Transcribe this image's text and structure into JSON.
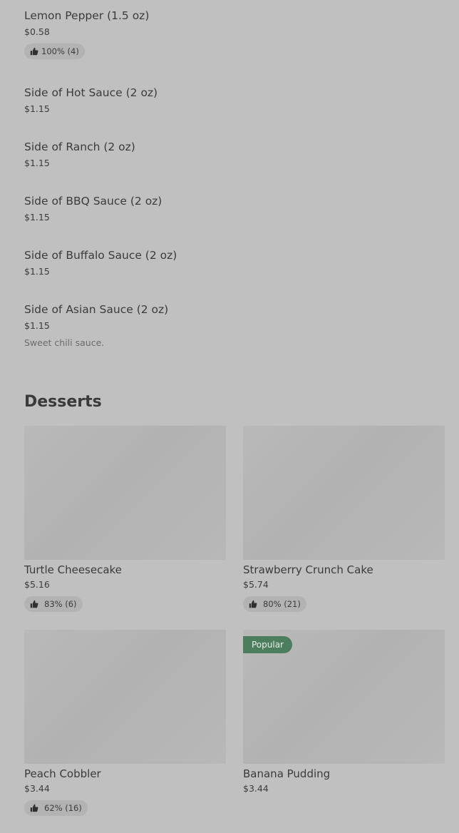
{
  "items": [
    {
      "title": "Lemon Pepper (1.5 oz)",
      "price": "$0.58",
      "rating": "100% (4)"
    },
    {
      "title": "Side of Hot Sauce (2 oz)",
      "price": "$1.15"
    },
    {
      "title": "Side of Ranch (2 oz)",
      "price": "$1.15"
    },
    {
      "title": "Side of BBQ Sauce (2 oz)",
      "price": "$1.15"
    },
    {
      "title": "Side of Buffalo Sauce (2 oz)",
      "price": "$1.15"
    },
    {
      "title": "Side of Asian Sauce (2 oz)",
      "price": "$1.15",
      "description": "Sweet chili sauce."
    }
  ],
  "desserts": {
    "heading": "Desserts",
    "cards": [
      {
        "title": "Turtle Cheesecake",
        "price": "$5.16",
        "rating": "83% (6)"
      },
      {
        "title": "Strawberry Crunch Cake",
        "price": "$5.74",
        "rating": "80% (21)"
      },
      {
        "title": "Peach Cobbler",
        "price": "$3.44",
        "rating": "62% (16)"
      },
      {
        "title": "Banana Pudding",
        "price": "$3.44",
        "badge": "Popular"
      }
    ]
  },
  "icons": {
    "thumbs_up": "thumbs-up-icon"
  },
  "colors": {
    "overlay_background": "#c0c0c0",
    "popular_badge": "#4c7e5d"
  }
}
